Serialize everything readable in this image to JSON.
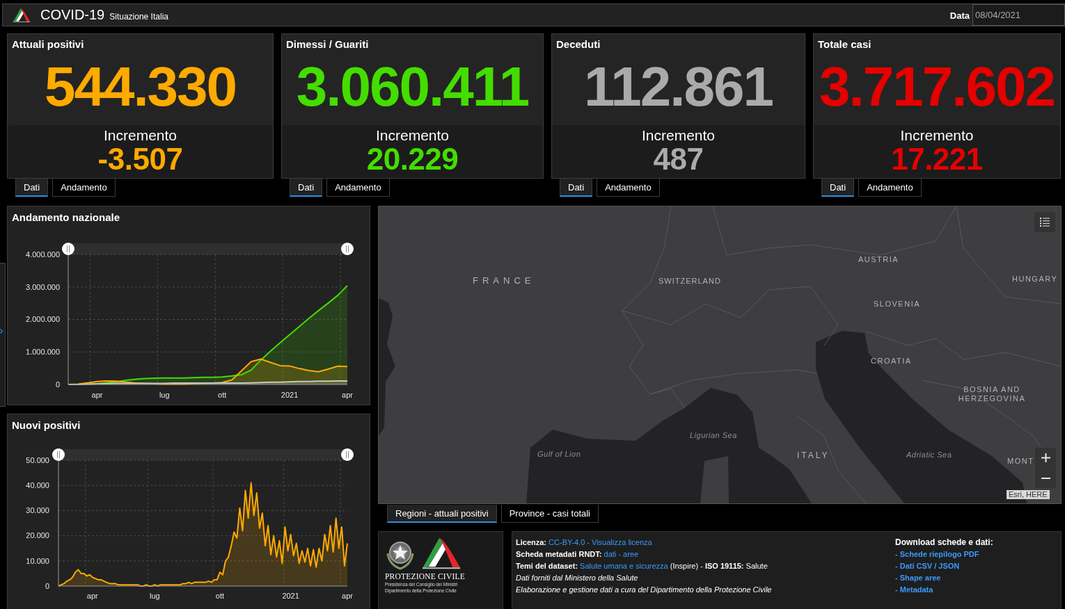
{
  "header": {
    "title": "COVID-19",
    "subtitle": "Situazione Italia",
    "date_label": "Data",
    "date_value": "08/04/2021"
  },
  "cards": [
    {
      "title": "Attuali positivi",
      "value": "544.330",
      "color": "#ffaa00",
      "increment_label": "Incremento",
      "increment": "-3.507",
      "tabs": [
        {
          "label": "Dati",
          "selected": true
        },
        {
          "label": "Andamento",
          "selected": false
        }
      ]
    },
    {
      "title": "Dimessi / Guariti",
      "value": "3.060.411",
      "color": "#44dd00",
      "increment_label": "Incremento",
      "increment": "20.229",
      "tabs": [
        {
          "label": "Dati",
          "selected": true
        },
        {
          "label": "Andamento",
          "selected": false
        }
      ]
    },
    {
      "title": "Deceduti",
      "value": "112.861",
      "color": "#aaaaaa",
      "increment_label": "Incremento",
      "increment": "487",
      "tabs": [
        {
          "label": "Dati",
          "selected": true
        },
        {
          "label": "Andamento",
          "selected": false
        }
      ]
    },
    {
      "title": "Totale casi",
      "value": "3.717.602",
      "color": "#e60000",
      "increment_label": "Incremento",
      "increment": "17.221",
      "tabs": [
        {
          "label": "Dati",
          "selected": true
        },
        {
          "label": "Andamento",
          "selected": false
        }
      ]
    }
  ],
  "charts": [
    {
      "title": "Andamento nazionale",
      "chart_data": {
        "type": "area",
        "grid": true,
        "categories": [
          null,
          null,
          null,
          "apr",
          null,
          null,
          null,
          null,
          null,
          null,
          "lug",
          null,
          null,
          null,
          null,
          null,
          "ott",
          null,
          null,
          null,
          null,
          null,
          null,
          "2021",
          null,
          null,
          null,
          null,
          null,
          "apr"
        ],
        "ylim": [
          0,
          4000000
        ],
        "yticks": [
          {
            "value": 0,
            "label": "0"
          },
          {
            "value": 1000000,
            "label": "1.000.000"
          },
          {
            "value": 2000000,
            "label": "2.000.000"
          },
          {
            "value": 3000000,
            "label": "3.000.000"
          },
          {
            "value": 4000000,
            "label": "4.000.000"
          }
        ],
        "series": [
          {
            "color": "#44dd00",
            "values": [
              0,
              0,
              10000,
              20000,
              50000,
              80000,
              130000,
              160000,
              180000,
              190000,
              200000,
              200000,
              200000,
              210000,
              220000,
              220000,
              230000,
              260000,
              300000,
              440000,
              750000,
              1020000,
              1280000,
              1530000,
              1780000,
              2030000,
              2270000,
              2500000,
              2740000,
              3040000
            ]
          },
          {
            "color": "#ffaa00",
            "values": [
              0,
              10000,
              50000,
              90000,
              110000,
              100000,
              70000,
              40000,
              30000,
              20000,
              10000,
              10000,
              10000,
              20000,
              30000,
              40000,
              60000,
              140000,
              420000,
              700000,
              780000,
              680000,
              580000,
              570000,
              490000,
              430000,
              390000,
              470000,
              560000,
              550000
            ]
          },
          {
            "color": "#c8c8c8",
            "values": [
              0,
              0,
              10000,
              20000,
              20000,
              30000,
              30000,
              30000,
              30000,
              30000,
              30000,
              40000,
              40000,
              40000,
              40000,
              40000,
              40000,
              40000,
              40000,
              50000,
              60000,
              70000,
              70000,
              80000,
              90000,
              90000,
              100000,
              100000,
              110000,
              110000
            ]
          }
        ]
      }
    },
    {
      "title": "Nuovi positivi",
      "chart_data": {
        "type": "area",
        "grid": true,
        "categories": [
          null,
          null,
          null,
          null,
          null,
          null,
          null,
          null,
          null,
          null,
          null,
          null,
          "apr",
          null,
          null,
          null,
          null,
          null,
          null,
          null,
          null,
          null,
          null,
          null,
          null,
          null,
          null,
          null,
          null,
          null,
          null,
          null,
          null,
          null,
          "lug",
          null,
          null,
          null,
          null,
          null,
          null,
          null,
          null,
          null,
          null,
          null,
          null,
          null,
          null,
          null,
          null,
          null,
          null,
          null,
          null,
          null,
          null,
          "ott",
          null,
          null,
          null,
          null,
          null,
          null,
          null,
          null,
          null,
          null,
          null,
          null,
          null,
          null,
          null,
          null,
          null,
          null,
          null,
          null,
          null,
          null,
          null,
          null,
          "2021",
          null,
          null,
          null,
          null,
          null,
          null,
          null,
          null,
          null,
          null,
          null,
          null,
          null,
          null,
          null,
          null,
          null,
          null,
          null,
          "apr"
        ],
        "ylim": [
          0,
          50000
        ],
        "yticks": [
          {
            "value": 0,
            "label": "0"
          },
          {
            "value": 10000,
            "label": "10.000"
          },
          {
            "value": 20000,
            "label": "20.000"
          },
          {
            "value": 30000,
            "label": "30.000"
          },
          {
            "value": 40000,
            "label": "40.000"
          },
          {
            "value": 50000,
            "label": "50.000"
          }
        ],
        "series": [
          {
            "color": "#ffaa00",
            "values": [
              0,
              500,
              1000,
              2000,
              2500,
              3500,
              5500,
              6500,
              5000,
              5000,
              4000,
              4500,
              3500,
              3000,
              2500,
              2500,
              2000,
              1500,
              1000,
              1000,
              1000,
              500,
              500,
              500,
              500,
              500,
              500,
              500,
              500,
              0,
              0,
              500,
              0,
              0,
              500,
              0,
              500,
              500,
              500,
              500,
              500,
              500,
              500,
              500,
              1000,
              1000,
              1500,
              1000,
              1500,
              1500,
              1500,
              1500,
              1500,
              2000,
              1500,
              2500,
              2500,
              5500,
              4500,
              10000,
              11500,
              16000,
              21500,
              19000,
              31000,
              22000,
              38000,
              27000,
              41000,
              28000,
              37000,
              23000,
              29000,
              16000,
              24000,
              12500,
              20000,
              11500,
              18000,
              9000,
              23500,
              14000,
              20500,
              12000,
              17000,
              9000,
              14000,
              9500,
              15000,
              8000,
              14500,
              7500,
              15000,
              10000,
              20500,
              14000,
              24000,
              13500,
              27000,
              15000,
              23500,
              8000,
              17000
            ]
          }
        ]
      }
    }
  ],
  "map": {
    "labels": [
      {
        "text": "FRANCE",
        "kind": "country"
      },
      {
        "text": "SWITZERLAND",
        "kind": "country"
      },
      {
        "text": "AUSTRIA",
        "kind": "country"
      },
      {
        "text": "HUNGARY",
        "kind": "country"
      },
      {
        "text": "SLOVENIA",
        "kind": "country"
      },
      {
        "text": "CROATIA",
        "kind": "country"
      },
      {
        "text": "BOSNIA AND HERZEGOVINA",
        "kind": "country"
      },
      {
        "text": "Ligurian Sea",
        "kind": "sea"
      },
      {
        "text": "Gulf of Lion",
        "kind": "sea"
      },
      {
        "text": "ITALY",
        "kind": "country"
      },
      {
        "text": "Adriatic Sea",
        "kind": "sea"
      },
      {
        "text": "MONT",
        "kind": "country"
      }
    ],
    "attribution": "Esri, HERE"
  },
  "map_tabs": [
    {
      "label": "Regioni - attuali positivi",
      "selected": true
    },
    {
      "label": "Province - casi totali",
      "selected": false
    }
  ],
  "footer": {
    "logo": {
      "name": "PROTEZIONE CIVILE",
      "lines": [
        "Presidenza del Consiglio dei Ministri",
        "Dipartimento della Protezione Civile"
      ]
    },
    "info_lines": [
      [
        {
          "kind": "bold",
          "text": "Licenza: "
        },
        {
          "kind": "link",
          "text": "CC-BY-4.0"
        },
        {
          "kind": "sep",
          "text": " - "
        },
        {
          "kind": "link",
          "text": "Visualizza licenza"
        }
      ],
      [
        {
          "kind": "bold",
          "text": "Scheda metadati RNDT: "
        },
        {
          "kind": "link",
          "text": "dati"
        },
        {
          "kind": "sep",
          "text": " - "
        },
        {
          "kind": "link",
          "text": "aree"
        }
      ],
      [
        {
          "kind": "bold",
          "text": "Temi del dataset: "
        },
        {
          "kind": "link",
          "text": "Salute umana e sicurezza"
        },
        {
          "kind": "text",
          "text": " (Inspire) - "
        },
        {
          "kind": "bold",
          "text": "ISO 19115:"
        },
        {
          "kind": "text",
          "text": " Salute"
        }
      ],
      [
        {
          "kind": "italic",
          "text": "Dati forniti dal Ministero della Salute"
        }
      ],
      [
        {
          "kind": "italic",
          "text": "Elaborazione e gestione dati a cura del Dipartimento della Protezione Civile"
        }
      ]
    ],
    "downloads": {
      "title": "Download schede e dati:",
      "items": [
        "- Schede riepilogo PDF",
        "- Dati CSV / JSON",
        "- Shape aree",
        "- Metadata"
      ]
    }
  }
}
